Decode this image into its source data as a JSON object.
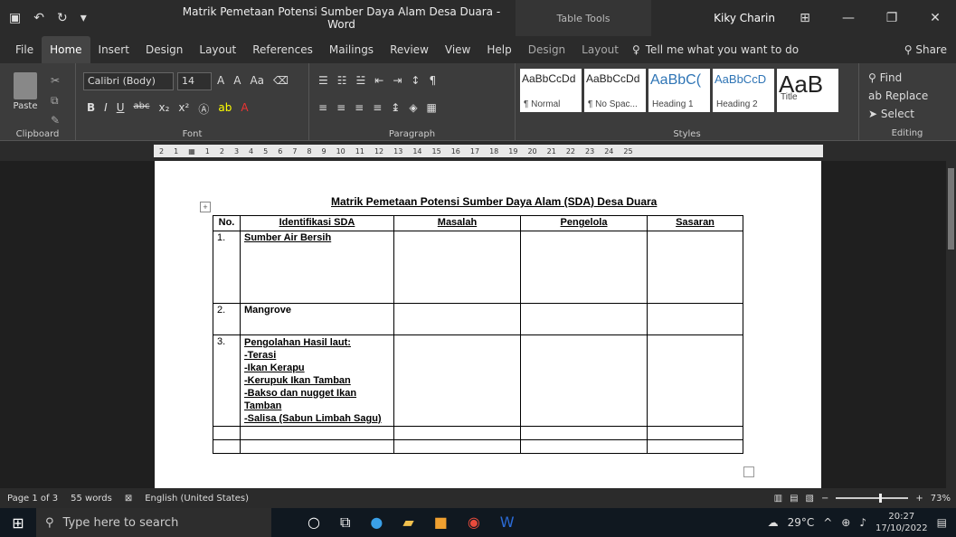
{
  "titlebar": {
    "doc_title": "Matrik Pemetaan Potensi Sumber Daya Alam Desa Duara  -  Word",
    "table_tools": "Table Tools",
    "user": "Kiky Charin"
  },
  "tabs": {
    "items": [
      "File",
      "Home",
      "Insert",
      "Design",
      "Layout",
      "References",
      "Mailings",
      "Review",
      "View",
      "Help"
    ],
    "ctx": [
      "Design",
      "Layout"
    ],
    "tell_me": "Tell me what you want to do",
    "share": "Share"
  },
  "ribbon": {
    "paste": "Paste",
    "clipboard": "Clipboard",
    "font_name": "Calibri (Body)",
    "font_size": "14",
    "font": "Font",
    "paragraph": "Paragraph",
    "styles": "Styles",
    "editing": "Editing",
    "style_items": [
      {
        "preview": "AaBbCcDd",
        "name": "¶ Normal"
      },
      {
        "preview": "AaBbCcDd",
        "name": "¶ No Spac..."
      },
      {
        "preview": "AaBbC(",
        "name": "Heading 1"
      },
      {
        "preview": "AaBbCcD",
        "name": "Heading 2"
      },
      {
        "preview": "AaB",
        "name": "Title"
      }
    ],
    "find": "Find",
    "replace": "Replace",
    "select": "Select"
  },
  "document": {
    "heading": "Matrik Pemetaan Potensi Sumber Daya Alam (SDA) Desa Duara",
    "headers": [
      "No.",
      "Identifikasi SDA",
      "Masalah",
      "Pengelola",
      "Sasaran"
    ],
    "rows": [
      {
        "no": "1.",
        "lines": [
          "Sumber Air Bersih"
        ]
      },
      {
        "no": "2.",
        "lines": [
          "Mangrove"
        ]
      },
      {
        "no": "3.",
        "lines": [
          "Pengolahan Hasil laut:",
          "-Terasi",
          "-Ikan Kerapu",
          "-Kerupuk Ikan Tamban",
          "-Bakso dan nugget Ikan",
          "Tamban",
          "-Salisa (Sabun Limbah Sagu)"
        ]
      }
    ]
  },
  "status": {
    "page": "Page 1 of 3",
    "words": "55 words",
    "language": "English (United States)",
    "zoom": "73%"
  },
  "taskbar": {
    "search_placeholder": "Type here to search",
    "temp": "29°C",
    "time": "20:27",
    "date": "17/10/2022"
  }
}
